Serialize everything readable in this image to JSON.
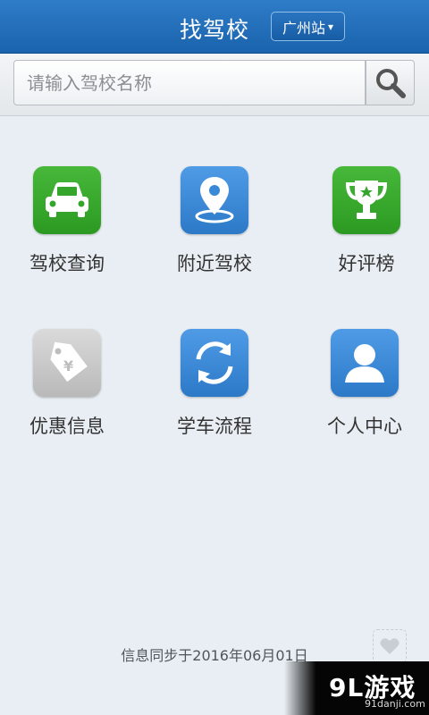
{
  "header": {
    "title": "找驾校",
    "city_label": "广州站",
    "city_caret": "▾"
  },
  "search": {
    "placeholder": "请输入驾校名称",
    "icon": "search-icon"
  },
  "menu": {
    "items": [
      {
        "label": "驾校查询",
        "icon": "car-icon",
        "color": "#3aaa30"
      },
      {
        "label": "附近驾校",
        "icon": "location-pin-icon",
        "color": "#3a88d8"
      },
      {
        "label": "好评榜",
        "icon": "trophy-icon",
        "color": "#3aaa30"
      },
      {
        "label": "优惠信息",
        "icon": "price-tag-icon",
        "color": "#c4c4c4"
      },
      {
        "label": "学车流程",
        "icon": "cycle-arrows-icon",
        "color": "#3a88d8"
      },
      {
        "label": "个人中心",
        "icon": "user-icon",
        "color": "#3a88d8"
      }
    ]
  },
  "footer": {
    "sync_text": "信息同步于2016年06月01日",
    "favorite_icon": "heart-icon"
  },
  "watermark": {
    "brand": "9L游戏",
    "url": "91danji.com"
  }
}
